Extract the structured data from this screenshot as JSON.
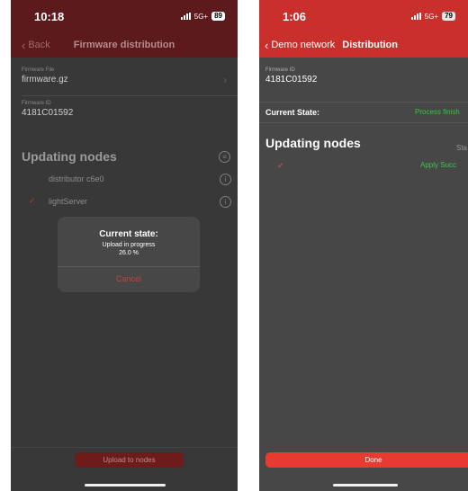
{
  "screen_left": {
    "status_bar": {
      "time": "10:18",
      "network": "5G+",
      "battery": "89"
    },
    "nav": {
      "back_label": "Back",
      "title": "Firmware distribution"
    },
    "firmware_file": {
      "label": "Firmware File",
      "value": "firmware.gz"
    },
    "firmware_id": {
      "label": "Firmware ID",
      "value": "4181C01592"
    },
    "updating_nodes_title": "Updating nodes",
    "nodes": [
      {
        "name": "distributor c6e0",
        "checked": false
      },
      {
        "name": "lightServer",
        "checked": true
      }
    ],
    "dialog": {
      "title": "Current state:",
      "message_line1": "Upload in progress",
      "message_line2": "26.0 %",
      "cancel_label": "Cancel"
    },
    "upload_button": "Upload to nodes"
  },
  "screen_right": {
    "status_bar": {
      "time": "1:06",
      "network": "5G+",
      "battery": "79"
    },
    "nav": {
      "back_label": "Demo network",
      "title": "Distribution"
    },
    "firmware_id": {
      "label": "Firmware ID",
      "value": "4181C01592"
    },
    "current_state": {
      "label": "Current State:",
      "value": "Process finish"
    },
    "updating_nodes_title": "Updating nodes",
    "status_column_header": "Sta",
    "nodes": [
      {
        "checked": true,
        "status": "Apply Succ"
      }
    ],
    "done_button": "Done"
  },
  "colors": {
    "dark_red_bar": "#5c1a1c",
    "red_bar": "#c9302c",
    "success_green": "#34c73a",
    "done_red": "#e73a30"
  },
  "icons": [
    "chevron-left-icon",
    "signal-icon",
    "filter-icon",
    "info-icon",
    "checkmark-icon"
  ]
}
